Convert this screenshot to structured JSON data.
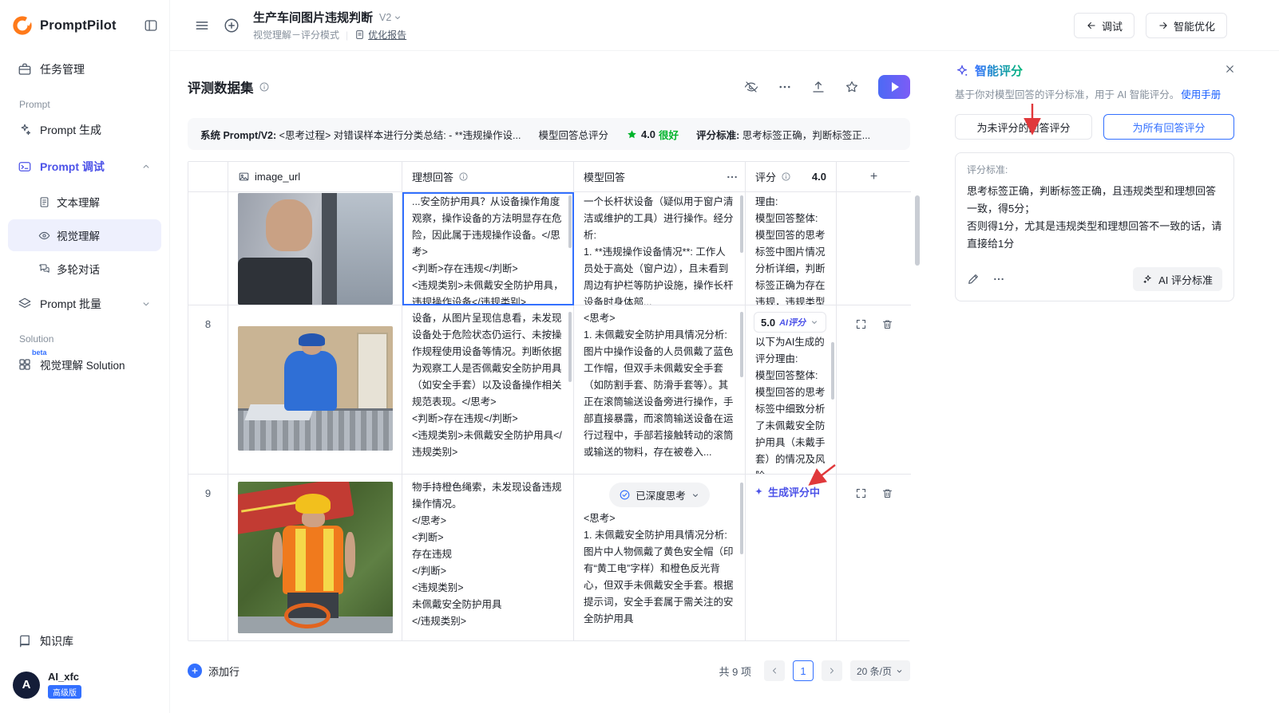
{
  "colors": {
    "accent_indigo": "#4d53e8",
    "link_blue": "#3370ff",
    "success_green": "#00b42a",
    "annotation_red": "#e0383b",
    "selected_cell_border": "#3370ff",
    "play_gradient": [
      "#4c6af5",
      "#7c5cf6"
    ]
  },
  "sidebar": {
    "logo_text": "PromptPilot",
    "task_mgmt": "任务管理",
    "prompt_section": "Prompt",
    "prompt_gen": "Prompt 生成",
    "prompt_debug": "Prompt 调试",
    "text_understanding": "文本理解",
    "visual_understanding": "视觉理解",
    "multi_turn": "多轮对话",
    "prompt_batch": "Prompt 批量",
    "solution_section": "Solution",
    "beta_tag": "beta",
    "solution_item": "视觉理解 Solution",
    "knowledge_base": "知识库",
    "user": {
      "avatar": "A",
      "name": "AI_xfc",
      "badge": "高级版"
    }
  },
  "topbar": {
    "title": "生产车间图片违规判断",
    "version": "V2",
    "mode": "视觉理解－评分模式",
    "report_link": "优化报告",
    "debug_btn": "调试",
    "optimize_btn": "智能优化"
  },
  "dataset": {
    "title": "评测数据集",
    "info_bar": {
      "system_prompt_label": "系统 Prompt/V2:",
      "system_prompt_text": "<思考过程> 对错误样本进行分类总结: - **违规操作设...",
      "model_score_label": "模型回答总评分",
      "score_value": "4.0",
      "score_level": "很好",
      "criteria_label": "评分标准:",
      "criteria_text": "思考标签正确，判断标签正..."
    },
    "table": {
      "header": {
        "image": "image_url",
        "ideal": "理想回答",
        "model": "模型回答",
        "score": "评分",
        "score_value": "4.0",
        "add": "+"
      },
      "rows": [
        {
          "num": "",
          "image_desc": "工人在窗边高处作业",
          "ideal": "...安全防护用具？从设备操作角度观察，操作设备的方法明显存在危险，因此属于违规操作设备。</思考>\n<判断>存在违规</判断>\n<违规类别>未佩戴安全防护用具，违规操作设备</违规类别>",
          "model": "一个长杆状设备（疑似用于窗户清洁或维护的工具）进行操作。经分析:\n1. **违规操作设备情况**: 工作人员处于高处（窗户边），且未看到周边有护栏等防护设施，操作长杆设备时身体部...",
          "score_text": "理由:\n模型回答整体: 模型回答的思考标签中图片情况分析详细，判断标签正确为存在违规，违规类型与..."
        },
        {
          "num": "8",
          "image_desc": "车间内佩戴蓝色工作帽的工人在滚筒输送设备旁操作",
          "ideal": "设备，从图片呈现信息看，未发现设备处于危险状态仍运行、未按操作规程使用设备等情况。判断依据为观察工人是否佩戴安全防护用具（如安全手套）以及设备操作相关规范表现。</思考>\n<判断>存在违规</判断>\n<违规类别>未佩戴安全防护用具</违规类别>",
          "model": "<思考>\n1. 未佩戴安全防护用具情况分析: 图片中操作设备的人员佩戴了蓝色工作帽，但双手未佩戴安全手套（如防割手套、防滑手套等）。其正在滚筒输送设备旁进行操作，手部直接暴露，而滚筒输送设备在运行过程中，手部若接触转动的滚筒或输送的物料，存在被卷入...",
          "score_value": "5.0",
          "score_tag": "AI评分",
          "score_text": "以下为AI生成的评分理由:\n模型回答整体: 模型回答的思考标签中细致分析了未佩戴安全防护用具（未戴手套）的情况及风险..."
        },
        {
          "num": "9",
          "image_desc": "佩戴黄色安全帽和橙色反光背心、手持橙色绳索的工人",
          "ideal": "物手持橙色绳索，未发现设备违规操作情况。\n</思考>\n<判断>\n存在违规\n</判断>\n<违规类别>\n未佩戴安全防护用具\n</违规类别>",
          "model_badge": "已深度思考",
          "model": "<思考>\n1. 未佩戴安全防护用具情况分析: 图片中人物佩戴了黄色安全帽（印有“黄工电”字样）和橙色反光背心，但双手未佩戴安全手套。根据提示词，安全手套属于需关注的安全防护用具",
          "score_status": "生成评分中"
        }
      ]
    },
    "footer": {
      "add_row": "添加行",
      "total": "共 9 项",
      "page": "1",
      "page_size": "20 条/页"
    }
  },
  "panel": {
    "title": "智能评分",
    "desc": "基于你对模型回答的评分标准，用于 AI 智能评分。",
    "manual_link": "使用手册",
    "score_unscored_btn": "为未评分的回答评分",
    "score_all_btn": "为所有回答评分",
    "criteria_label": "评分标准:",
    "criteria_text": "思考标签正确，判断标签正确，且违规类型和理想回答一致，得5分；\n否则得1分，尤其是违规类型和理想回答不一致的话，请直接给1分",
    "ai_criteria_btn": "AI 评分标准"
  }
}
